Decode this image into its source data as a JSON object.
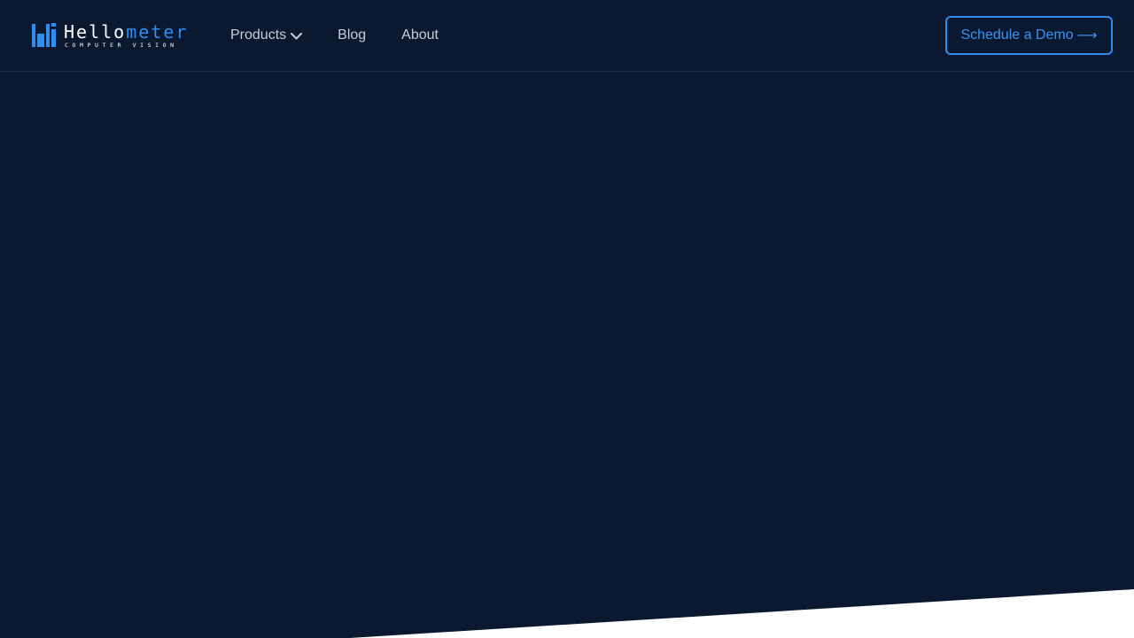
{
  "brand": {
    "name_primary": "Hello",
    "name_accent": "meter",
    "tagline": "COMPUTER VISION",
    "logo_icon": "hellometer-logo-icon"
  },
  "nav": {
    "items": [
      {
        "label": "Products",
        "has_dropdown": true,
        "icon": "chevron-down-icon"
      },
      {
        "label": "Blog"
      },
      {
        "label": "About"
      }
    ]
  },
  "cta": {
    "label": "Schedule a Demo",
    "arrow": "⟶"
  },
  "colors": {
    "background": "#0b1930",
    "accent": "#2f8ff0",
    "nav_text": "#c7ccd6",
    "divider": "#ffffff"
  }
}
